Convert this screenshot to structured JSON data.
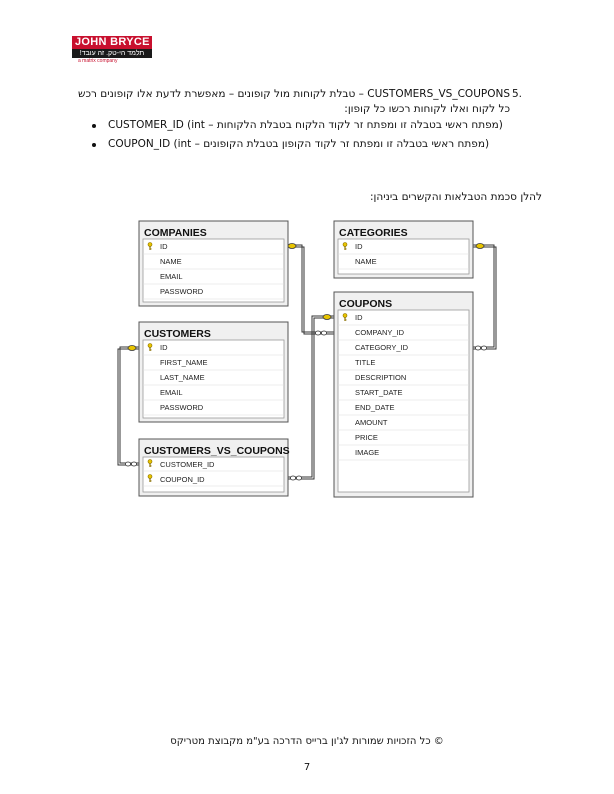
{
  "logo": {
    "brand": "JOHN BRYCE",
    "tagline": "תלמד הי-טק. זה עובד!",
    "sub": "a matrix company"
  },
  "item": {
    "number": "5.",
    "line1": "CUSTOMERS_VS_COUPONS – טבלת לקוחות מול קופונים – מאפשרת לדעת אלו קופונים רכש",
    "line2": "כל לקוח ואלו לקוחות רכשו כל קופון:",
    "bullets": [
      "CUSTOMER_ID (int – מפתח ראשי בטבלה זו ומפתח זר לקוד הלקוח בטבלת הלקוחות)",
      "COUPON_ID (int – מפתח ראשי בטבלה זו ומפתח זר לקוד הקופון בטבלת הקופונים)"
    ]
  },
  "diagram_intro": "להלן סכמת הטבלאות והקשרים ביניהן:",
  "tables": [
    {
      "name": "COMPANIES",
      "fields": [
        "ID",
        "NAME",
        "EMAIL",
        "PASSWORD"
      ],
      "key_fields": [
        "ID"
      ]
    },
    {
      "name": "CATEGORIES",
      "fields": [
        "ID",
        "NAME"
      ],
      "key_fields": [
        "ID"
      ]
    },
    {
      "name": "CUSTOMERS",
      "fields": [
        "ID",
        "FIRST_NAME",
        "LAST_NAME",
        "EMAIL",
        "PASSWORD"
      ],
      "key_fields": [
        "ID"
      ]
    },
    {
      "name": "COUPONS",
      "fields": [
        "ID",
        "COMPANY_ID",
        "CATEGORY_ID",
        "TITLE",
        "DESCRIPTION",
        "START_DATE",
        "END_DATE",
        "AMOUNT",
        "PRICE",
        "IMAGE"
      ],
      "key_fields": [
        "ID"
      ]
    },
    {
      "name": "CUSTOMERS_VS_COUPONS",
      "fields": [
        "CUSTOMER_ID",
        "COUPON_ID"
      ],
      "key_fields": [
        "CUSTOMER_ID",
        "COUPON_ID"
      ]
    }
  ],
  "relationships": [
    {
      "from": "COMPANIES.ID",
      "to": "COUPONS.COMPANY_ID"
    },
    {
      "from": "CATEGORIES.ID",
      "to": "COUPONS.CATEGORY_ID"
    },
    {
      "from": "CUSTOMERS.ID",
      "to": "CUSTOMERS_VS_COUPONS.CUSTOMER_ID"
    },
    {
      "from": "COUPONS.ID",
      "to": "CUSTOMERS_VS_COUPONS.COUPON_ID"
    }
  ],
  "colors": {
    "key_icon": "#e8c400",
    "logo_red": "#c8102e"
  },
  "footer": {
    "copyright": "© כל הזכויות שמורות לג'ון ברייס הדרכה בע\"מ מקבוצת מטריקס",
    "page_number": "7"
  }
}
